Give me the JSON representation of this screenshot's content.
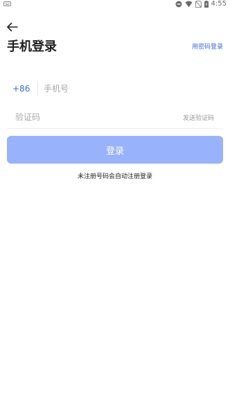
{
  "status_bar": {
    "time": "4:55",
    "left_icon": "keyboard-icon",
    "right_icons": [
      "do-not-disturb-icon",
      "wifi-icon",
      "no-sim-icon",
      "battery-icon"
    ]
  },
  "header": {
    "back_icon": "back-arrow-icon",
    "title": "手机登录",
    "password_login_label": "用密码登录"
  },
  "form": {
    "country_code": "+86",
    "phone_placeholder": "手机号",
    "phone_value": "",
    "code_placeholder": "验证码",
    "code_value": "",
    "send_code_label": "发送验证码"
  },
  "login_button": {
    "label": "登录"
  },
  "hint": "未注册号码会自动注册登录",
  "colors": {
    "accent": "#3a6bdc",
    "button_disabled": "#98b3fb",
    "text_primary": "#1f1f1f",
    "placeholder": "#a8a8a8"
  }
}
